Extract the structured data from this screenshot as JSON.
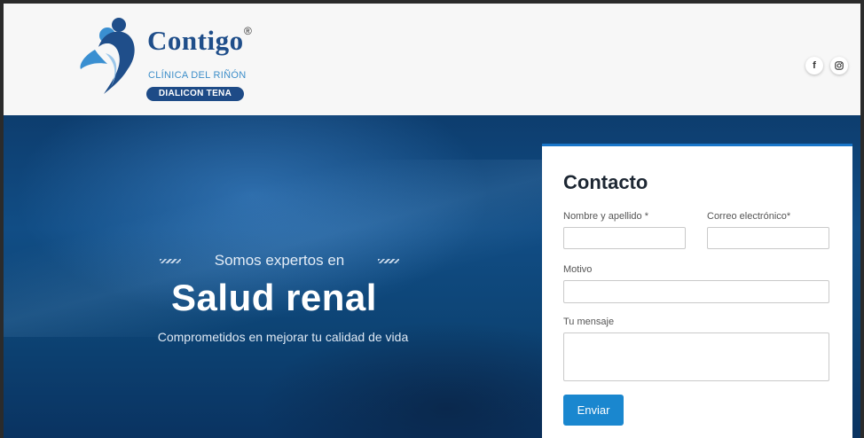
{
  "header": {
    "brand_name": "Contigo",
    "registered_mark": "®",
    "subtitle": "CLÍNICA DEL RIÑÓN",
    "badge": "DIALICON TENA",
    "social": [
      {
        "icon": "facebook-icon",
        "label": "f"
      },
      {
        "icon": "instagram-icon"
      }
    ]
  },
  "hero": {
    "tagline": "Somos expertos en",
    "headline": "Salud renal",
    "subline": "Comprometidos en mejorar tu calidad de vida"
  },
  "contact_form": {
    "title": "Contacto",
    "name_label": "Nombre y apellido *",
    "email_label": "Correo electrónico*",
    "reason_label": "Motivo",
    "message_label": "Tu mensaje",
    "submit_label": "Enviar",
    "name_value": "",
    "email_value": "",
    "reason_value": "",
    "message_value": ""
  },
  "colors": {
    "brand_blue": "#1f4e8a",
    "accent_blue": "#1a87cf",
    "hero_dark": "#0d3d6e"
  }
}
